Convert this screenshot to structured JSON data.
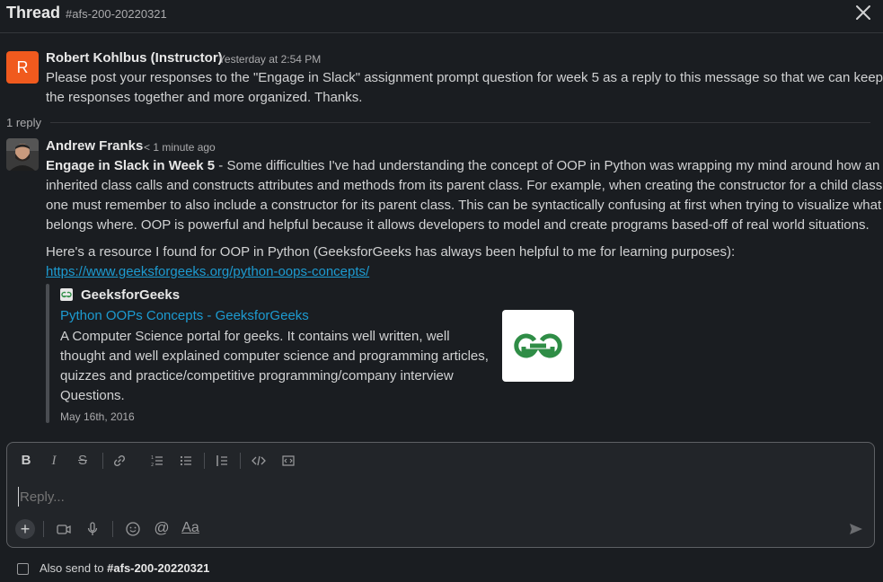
{
  "header": {
    "title": "Thread",
    "channel": "#afs-200-20220321",
    "close_icon": "close-icon"
  },
  "parent_message": {
    "avatar_letter": "R",
    "avatar_color": "#f05a1e",
    "author": "Robert Kohlbus (Instructor)",
    "timestamp": "Yesterday at 2:54 PM",
    "lines": [
      "Please post your responses to the \"Engage in Slack\" assignment prompt question for week 5 as a reply to this message so that we can keep",
      "the responses together and more organized. Thanks."
    ]
  },
  "reply_count": "1 reply",
  "reply": {
    "author": "Andrew Franks",
    "timestamp": "1 minute ago",
    "bold_lead": "Engage in Slack in Week 5",
    "lines": [
      " - Some difficulties I've had understanding the concept of OOP in Python was wrapping my mind around how an",
      "inherited class calls and constructs attributes and methods from its parent class. For example, when creating the constructor for a child class,",
      "one must remember to also include a constructor for its parent class. This can be syntactically confusing at first when trying to visualize what",
      "belongs where. OOP is powerful and helpful because it allows developers to model and create programs based-off of real world situations."
    ],
    "resource_text": "Here's a resource I found for OOP in Python (GeeksforGeeks has always been helpful to me for learning purposes):",
    "link": "https://www.geeksforgeeks.org/python-oops-concepts/",
    "unfurl": {
      "site": "GeeksforGeeks",
      "title": "Python OOPs Concepts - GeeksforGeeks",
      "desc_lines": [
        "A Computer Science portal for geeks. It contains well written, well",
        "thought and well explained computer science and programming articles,",
        "quizzes and practice/competitive programming/company interview",
        "Questions."
      ],
      "date": "May 16th, 2016",
      "brand_color": "#2f8d46"
    }
  },
  "composer": {
    "toolbar": [
      "bold-icon",
      "italic-icon",
      "strikethrough-icon",
      "link-icon",
      "ordered-list-icon",
      "bulleted-list-icon",
      "blockquote-icon",
      "code-icon",
      "code-block-icon"
    ],
    "placeholder": "Reply...",
    "bottom_icons": [
      "plus-icon",
      "video-icon",
      "microphone-icon",
      "emoji-icon",
      "mention-icon",
      "formatting-icon",
      "send-icon"
    ]
  },
  "also_send": {
    "label": "Also send to ",
    "channel": "#afs-200-20220321"
  }
}
